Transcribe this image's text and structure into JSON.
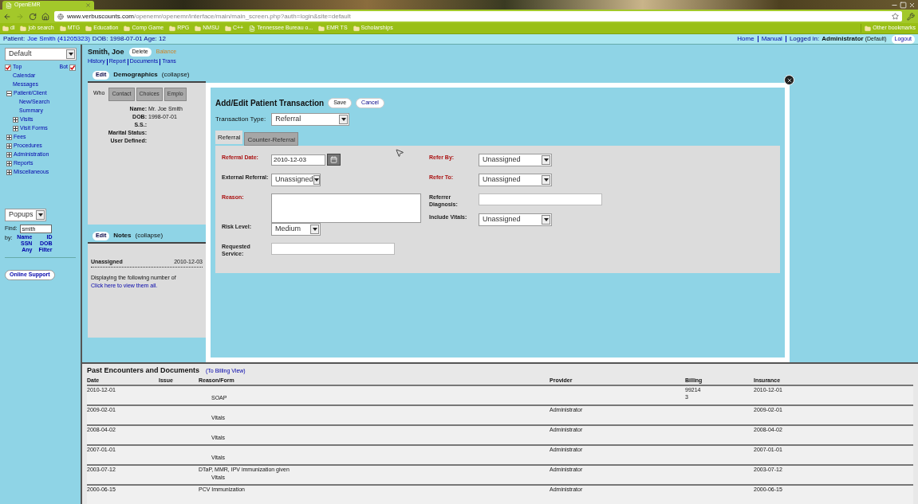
{
  "browser": {
    "tab_title": "OpenEMR",
    "url_host": "www.verbuscounts.com",
    "url_path": "/openemr/openemr/interface/main/main_screen.php?auth=login&site=default",
    "bookmarks": [
      {
        "label": "dl",
        "kind": "folder"
      },
      {
        "label": "job search",
        "kind": "folder"
      },
      {
        "label": "MTG",
        "kind": "folder"
      },
      {
        "label": "Education",
        "kind": "folder"
      },
      {
        "label": "Comp Game",
        "kind": "folder"
      },
      {
        "label": "RPG",
        "kind": "folder"
      },
      {
        "label": "NMSU",
        "kind": "folder"
      },
      {
        "label": "C++",
        "kind": "folder"
      },
      {
        "label": "Tennessee Bureau o...",
        "kind": "page"
      },
      {
        "label": "EMR TS",
        "kind": "folder"
      },
      {
        "label": "Scholarships",
        "kind": "folder"
      }
    ],
    "other_bookmarks": "Other bookmarks"
  },
  "patient_bar": {
    "label": "Patient:",
    "name": "Joe Smith (41205323)",
    "info": "DOB: 1998-07-01 Age: 12"
  },
  "top_links": {
    "home": "Home",
    "manual": "Manual",
    "logged_in": "Logged in:",
    "user": "Administrator",
    "site": "(Default)",
    "logout": "Logout"
  },
  "sidebar": {
    "view_select": "Default",
    "top": {
      "label": "Top",
      "checked": true
    },
    "bot": {
      "label": "Bot",
      "checked": true
    },
    "nav": [
      {
        "label": "Calendar"
      },
      {
        "label": "Messages"
      },
      {
        "label": "Patient/Client",
        "expanded": true,
        "children": [
          {
            "label": "New/Search"
          },
          {
            "label": "Summary"
          },
          {
            "label": "Visits",
            "expanded": false
          },
          {
            "label": "Visit Forms",
            "expanded": false
          }
        ]
      },
      {
        "label": "Fees",
        "expanded": false
      },
      {
        "label": "Procedures",
        "expanded": false
      },
      {
        "label": "Administration",
        "expanded": false
      },
      {
        "label": "Reports",
        "expanded": false
      },
      {
        "label": "Miscellaneous",
        "expanded": false
      }
    ],
    "popups_select": "Popups",
    "find_label": "Find:",
    "find_value": "smith",
    "by_label": "by:",
    "by_links": [
      "Name",
      "ID",
      "SSN",
      "DOB",
      "Any",
      "Filter"
    ],
    "support_button": "Online Support"
  },
  "summary": {
    "patient_name": "Smith, Joe",
    "delete_button": "Delete",
    "balance": "Balance",
    "links": [
      "History",
      "Report",
      "Documents",
      "Trans"
    ],
    "demographics": {
      "edit": "Edit",
      "title": "Demographics",
      "collapse": "(collapse)",
      "tabs": [
        {
          "label": "Who",
          "selected": true
        },
        {
          "label": "Contact",
          "selected": false
        },
        {
          "label": "Choices",
          "selected": false
        },
        {
          "label": "Emplo",
          "selected": false
        }
      ],
      "fields": [
        {
          "label": "Name:",
          "value": "Mr. Joe  Smith"
        },
        {
          "label": "DOB:",
          "value": "1998-07-01"
        },
        {
          "label": "S.S.:"
        },
        {
          "label": "Marital Status:"
        },
        {
          "label": "User Defined:"
        }
      ]
    },
    "notes": {
      "edit": "Edit",
      "title": "Notes",
      "collapse": "(collapse)",
      "note_author": "Unassigned",
      "note_date": "2010-12-03",
      "message": "Displaying the following number of",
      "link": "Click here to view them all."
    }
  },
  "modal": {
    "title": "Add/Edit Patient Transaction",
    "save": "Save",
    "cancel": "Cancel",
    "type_label": "Transaction Type:",
    "type_value": "Referral",
    "tabs": [
      {
        "label": "Referral",
        "selected": true
      },
      {
        "label": "Counter-Referral",
        "selected": false
      }
    ],
    "left_fields": [
      {
        "label": "Referral Date:",
        "kind": "date",
        "required": true,
        "value": "2010-12-03"
      },
      {
        "label": "External Referral:",
        "kind": "select",
        "required": false,
        "value": "Unassigned"
      },
      {
        "label": "Reason:",
        "kind": "textarea",
        "required": true
      },
      {
        "label": "Risk Level:",
        "kind": "select",
        "required": false,
        "value": "Medium"
      },
      {
        "label": "Requested Service:",
        "kind": "text",
        "required": false
      }
    ],
    "right_fields": [
      {
        "label": "Refer By:",
        "kind": "select",
        "required": true,
        "value": "Unassigned"
      },
      {
        "label": "Refer To:",
        "kind": "select",
        "required": true,
        "value": "Unassigned"
      },
      {
        "label": "Referrer Diagnosis:",
        "kind": "text",
        "required": false
      },
      {
        "label": "Include Vitals:",
        "kind": "select",
        "required": false,
        "value": "Unassigned"
      }
    ]
  },
  "encounters": {
    "title": "Past Encounters and Documents",
    "billing_link": "(To Billing View)",
    "columns": [
      "Date",
      "Issue",
      "Reason/Form",
      "Provider",
      "Billing",
      "Insurance"
    ],
    "rows": [
      {
        "date": "2010-12-01",
        "reason": "",
        "form": "SOAP",
        "provider": "",
        "billing": [
          "99214",
          "3"
        ],
        "insurance": "2010-12-01"
      },
      {
        "date": "2009-02-01",
        "reason": "",
        "form": "Vitals",
        "provider": "Administrator",
        "billing": [],
        "insurance": "2009-02-01"
      },
      {
        "date": "2008-04-02",
        "reason": "",
        "form": "Vitals",
        "provider": "Administrator",
        "billing": [],
        "insurance": "2008-04-02"
      },
      {
        "date": "2007-01-01",
        "reason": "",
        "form": "Vitals",
        "provider": "Administrator",
        "billing": [],
        "insurance": "2007-01-01"
      },
      {
        "date": "2003-07-12",
        "reason": "DTaP, MMR, IPV immunization given",
        "form": "Vitals",
        "provider": "Administrator",
        "billing": [],
        "insurance": "2003-07-12"
      },
      {
        "date": "2000-06-15",
        "reason": "PCV Immunization",
        "form": "",
        "provider": "Administrator",
        "billing": [],
        "insurance": "2000-06-15"
      }
    ]
  }
}
